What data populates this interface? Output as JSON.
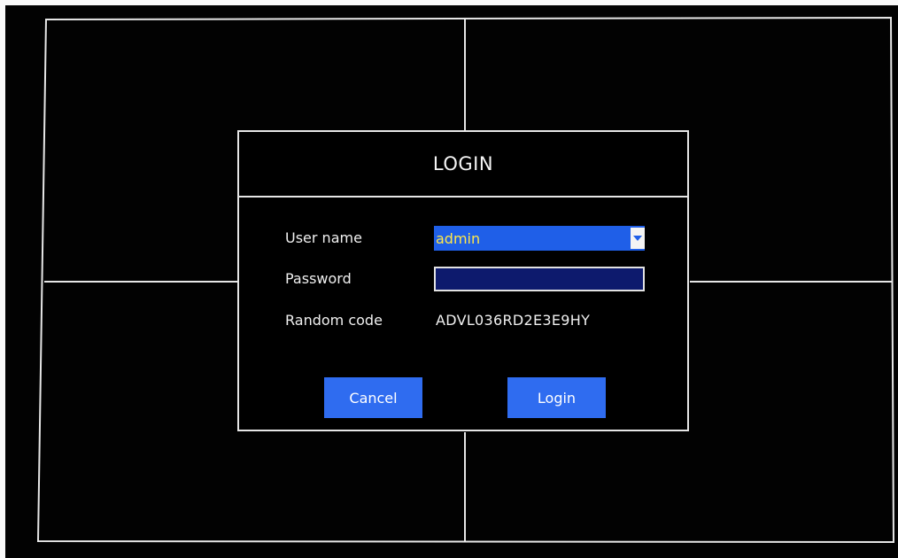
{
  "dialog": {
    "title": "LOGIN",
    "username_label": "User name",
    "username_value": "admin",
    "password_label": "Password",
    "password_value": "",
    "random_code_label": "Random code",
    "random_code_value": "ADVL036RD2E3E9HY",
    "cancel_label": "Cancel",
    "login_label": "Login"
  },
  "colors": {
    "background": "#020202",
    "grid_lines": "#e6e6e6",
    "select_bg": "#1f5fe8",
    "select_text": "#ffe84a",
    "password_bg": "#0d1a6d",
    "button_bg": "#2f6cf0"
  },
  "icons": {
    "dropdown": "chevron-down-icon"
  }
}
